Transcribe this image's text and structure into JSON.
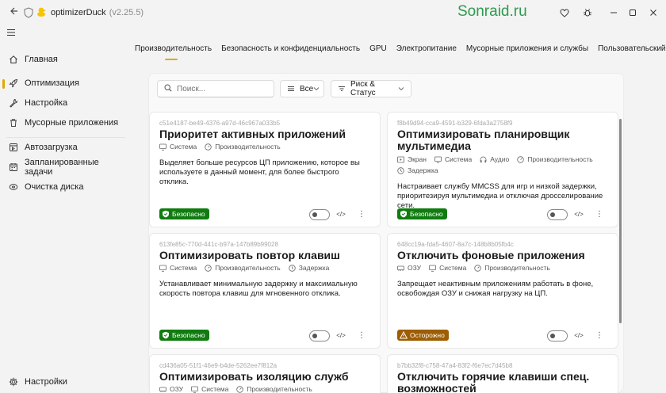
{
  "app": {
    "title": "optimizerDuck",
    "version": "(v2.25.5)",
    "watermark": "Sonraid.ru"
  },
  "sidebar": {
    "items": [
      {
        "label": "Главная",
        "icon": "home-icon"
      },
      {
        "label": "Оптимизация",
        "icon": "rocket-icon",
        "active": true
      },
      {
        "label": "Настройка",
        "icon": "wrench-icon"
      },
      {
        "label": "Мусорные приложения",
        "icon": "trash-icon"
      },
      {
        "label": "Автозагрузка",
        "icon": "startup-icon"
      },
      {
        "label": "Запланированные задачи",
        "icon": "calendar-icon"
      },
      {
        "label": "Очистка диска",
        "icon": "disk-icon"
      }
    ],
    "settings_label": "Настройки"
  },
  "tabs": [
    {
      "label": "Производительность",
      "active": true
    },
    {
      "label": "Безопасность и конфиденциальность"
    },
    {
      "label": "GPU"
    },
    {
      "label": "Электропитание"
    },
    {
      "label": "Мусорные приложения и службы"
    },
    {
      "label": "Пользовательский опыт"
    }
  ],
  "filters": {
    "search_placeholder": "Поиск...",
    "category_value": "Все",
    "risk_status_value": "Риск & Статус"
  },
  "cards": [
    {
      "id": "c51e4187-be49-4376-a97d-46c967a033b5",
      "title": "Приоритет активных приложений",
      "tags": [
        "Система",
        "Производительность"
      ],
      "description": "Выделяет больше ресурсов ЦП приложению, которое вы используете в данный момент, для более быстрого отклика.",
      "risk": "Безопасно"
    },
    {
      "id": "f8b49d94-cca9-4591-b329-6fda3a2758f9",
      "title": "Оптимизировать планировщик мультимедиа",
      "tags": [
        "Экран",
        "Система",
        "Аудио",
        "Производительность",
        "Задержка"
      ],
      "description": "Настраивает службу MMCSS для игр и низкой задержки, приоритезируя мультимедиа и отключая дросселирование сети.",
      "risk": "Безопасно"
    },
    {
      "id": "613fe85c-770d-441c-b97a-147b89b99028",
      "title": "Оптимизировать повтор клавиш",
      "tags": [
        "Система",
        "Производительность",
        "Задержка"
      ],
      "description": "Устанавливает минимальную задержку и максимальную скорость повтора клавиш для мгновенного отклика.",
      "risk": "Безопасно"
    },
    {
      "id": "648cc19a-fda5-4607-8a7c-148b8b05fb4c",
      "title": "Отключить фоновые приложения",
      "tags": [
        "ОЗУ",
        "Система",
        "Производительность"
      ],
      "description": "Запрещает неактивным приложениям работать в фоне, освобождая ОЗУ и снижая нагрузку на ЦП.",
      "risk": "Осторожно"
    },
    {
      "id": "cd436a05-51f1-46e9-b4de-5262ee7f812a",
      "title": "Оптимизировать изоляцию служб",
      "tags": [
        "ОЗУ",
        "Система",
        "Производительность"
      ],
      "description": "",
      "risk": ""
    },
    {
      "id": "b7bb32f8-c758-47a4-83f2-f6e7ec7d45b8",
      "title": "Отключить горячие клавиши спец. возможностей",
      "tags": [],
      "description": "",
      "risk": ""
    }
  ],
  "colors": {
    "accent": "#e0a800",
    "safe": "#107c10",
    "caution": "#9d5d00",
    "watermark": "#2e9b4f"
  }
}
